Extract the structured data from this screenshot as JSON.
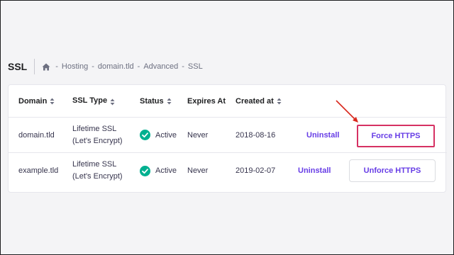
{
  "header": {
    "title": "SSL",
    "breadcrumb": [
      "Hosting",
      "domain.tld",
      "Advanced",
      "SSL"
    ],
    "separator": "-"
  },
  "table": {
    "columns": [
      "Domain",
      "SSL Type",
      "Status",
      "Expires At",
      "Created at"
    ],
    "rows": [
      {
        "domain": "domain.tld",
        "ssl_type_line1": "Lifetime SSL",
        "ssl_type_line2": "(Let's Encrypt)",
        "status": "Active",
        "expires": "Never",
        "created": "2018-08-16",
        "uninstall": "Uninstall",
        "action": "Force HTTPS"
      },
      {
        "domain": "example.tld",
        "ssl_type_line1": "Lifetime SSL",
        "ssl_type_line2": "(Let's Encrypt)",
        "status": "Active",
        "expires": "Never",
        "created": "2019-02-07",
        "uninstall": "Uninstall",
        "action": "Unforce HTTPS"
      }
    ]
  },
  "colors": {
    "accent": "#673de6",
    "status_ok": "#00b090",
    "highlight": "#d63163",
    "arrow": "#d9281c"
  },
  "icons": [
    "home-icon",
    "sort-icon",
    "check-circle-icon",
    "arrow-annotation"
  ]
}
